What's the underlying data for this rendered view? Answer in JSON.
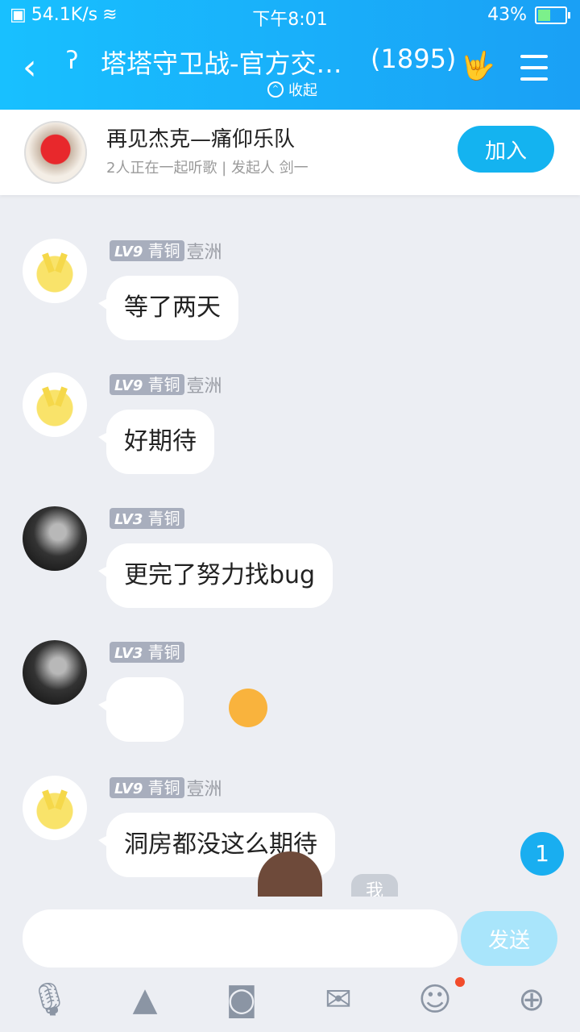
{
  "status": {
    "speed": "54.1K/s",
    "time": "下午8:01",
    "battery": "43%",
    "battery_level": 0.43
  },
  "header": {
    "title": "塔塔守卫战-官方交…",
    "member_count": "(1895)",
    "collapse_label": "收起"
  },
  "listen": {
    "song": "再见杰克—痛仰乐队",
    "subtitle": "2人正在一起听歌 | 发起人 剑一",
    "join_label": "加入"
  },
  "messages": [
    {
      "level": "LV9",
      "rank": "青铜",
      "nick": "壹洲",
      "text": "等了两天",
      "avatar": "pikachu"
    },
    {
      "level": "LV9",
      "rank": "青铜",
      "nick": "壹洲",
      "text": "好期待",
      "avatar": "pikachu"
    },
    {
      "level": "LV3",
      "rank": "青铜",
      "nick": "",
      "text": "更完了努力找bug",
      "avatar": "guitar"
    },
    {
      "level": "LV3",
      "rank": "青铜",
      "nick": "",
      "text": "",
      "avatar": "guitar",
      "emoji": "shiba-emoji"
    },
    {
      "level": "LV9",
      "rank": "青铜",
      "nick": "壹洲",
      "text": "洞房都没这么期待",
      "avatar": "pikachu"
    }
  ],
  "unread_count": "1",
  "me_label": "我",
  "input": {
    "placeholder": "",
    "send_label": "发送"
  },
  "tools": [
    "microphone-icon",
    "image-icon",
    "camera-icon",
    "red-packet-icon",
    "emoji-icon",
    "plus-icon"
  ],
  "colors": {
    "accent": "#1aa0f5",
    "join": "#14b3f0",
    "send_disabled": "#a9e5fb"
  }
}
